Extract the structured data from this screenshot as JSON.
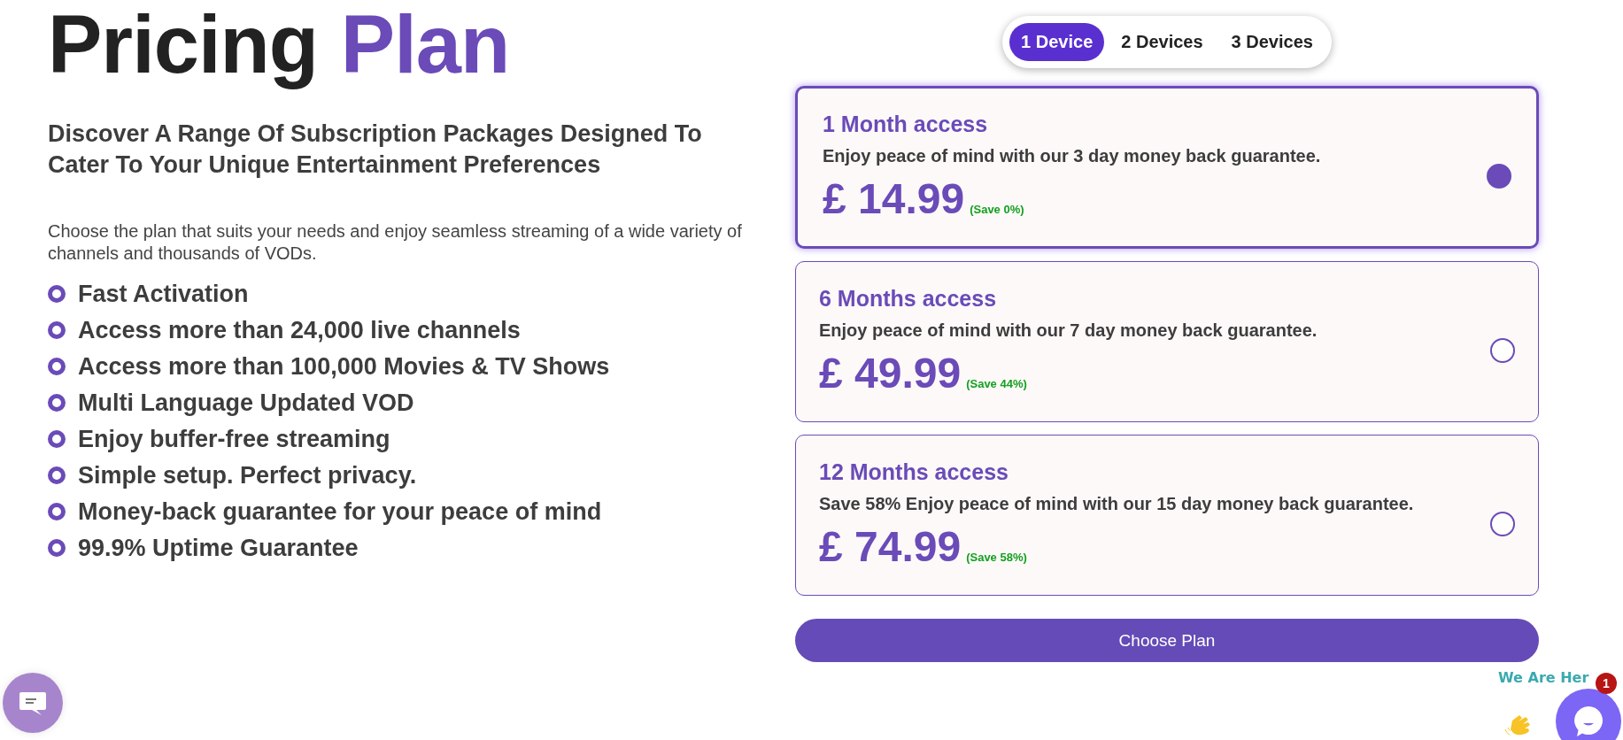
{
  "heading": {
    "part_1": "Pricing",
    "part_2": "Plan"
  },
  "subtitle": "Discover A Range Of Subscription Packages Designed To Cater To Your Unique Entertainment Preferences",
  "intro": "Choose the plan that suits your needs and enjoy seamless streaming of a wide variety of channels and thousands of VODs.",
  "features": [
    "Fast Activation",
    "Access more than 24,000 live channels",
    "Access more than 100,000 Movies & TV Shows",
    "Multi Language Updated VOD",
    "Enjoy buffer-free streaming",
    "Simple setup. Perfect privacy.",
    "Money-back guarantee for your peace of mind",
    "99.9% Uptime Guarantee"
  ],
  "device_tabs": [
    {
      "label": "1 Device",
      "selected": true
    },
    {
      "label": "2 Devices",
      "selected": false
    },
    {
      "label": "3 Devices",
      "selected": false
    }
  ],
  "plans": [
    {
      "title": "1 Month access",
      "description": "Enjoy peace of mind with our 3 day money back guarantee.",
      "price": "£ 14.99",
      "saving": "(Save 0%)",
      "selected": true
    },
    {
      "title": "6 Months access",
      "description": "Enjoy peace of mind with our 7 day money back guarantee.",
      "price": "£ 49.99",
      "saving": "(Save 44%)",
      "selected": false
    },
    {
      "title": "12 Months access",
      "description": "Save 58% Enjoy peace of mind with our 15 day money back guarantee.",
      "price": "£ 74.99",
      "saving": "(Save 58%)",
      "selected": false
    }
  ],
  "choose_button": "Choose Plan",
  "chat_widget": {
    "tagline": "We Are Her",
    "unread": "1"
  }
}
